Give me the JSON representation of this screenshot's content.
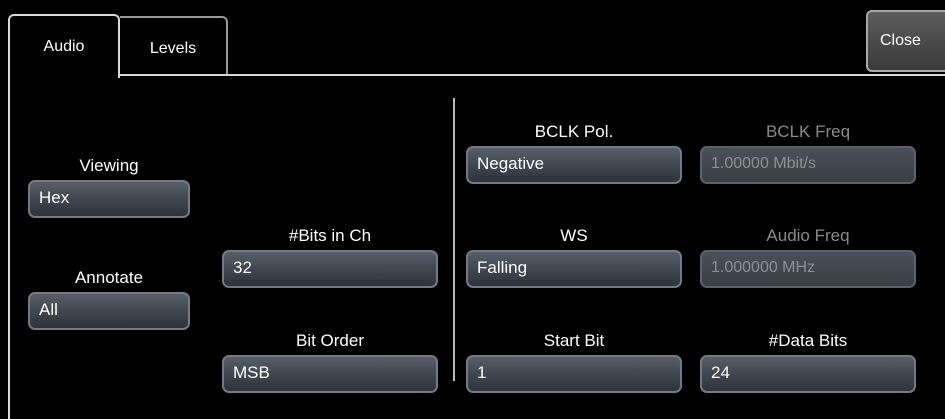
{
  "tabs": [
    {
      "label": "Audio"
    },
    {
      "label": "Levels"
    }
  ],
  "close_label": "Close",
  "viewing": {
    "label": "Viewing",
    "value": "Hex"
  },
  "annotate": {
    "label": "Annotate",
    "value": "All"
  },
  "bits_in_ch": {
    "label": "#Bits in Ch",
    "value": "32"
  },
  "bit_order": {
    "label": "Bit Order",
    "value": "MSB"
  },
  "bclk_pol": {
    "label": "BCLK Pol.",
    "value": "Negative"
  },
  "bclk_freq": {
    "label": "BCLK Freq",
    "value": "1.00000 Mbit/s"
  },
  "ws": {
    "label": "WS",
    "value": "Falling"
  },
  "audio_freq": {
    "label": "Audio Freq",
    "value": "1.000000 MHz"
  },
  "start_bit": {
    "label": "Start Bit",
    "value": "1"
  },
  "data_bits": {
    "label": "#Data Bits",
    "value": "24"
  }
}
